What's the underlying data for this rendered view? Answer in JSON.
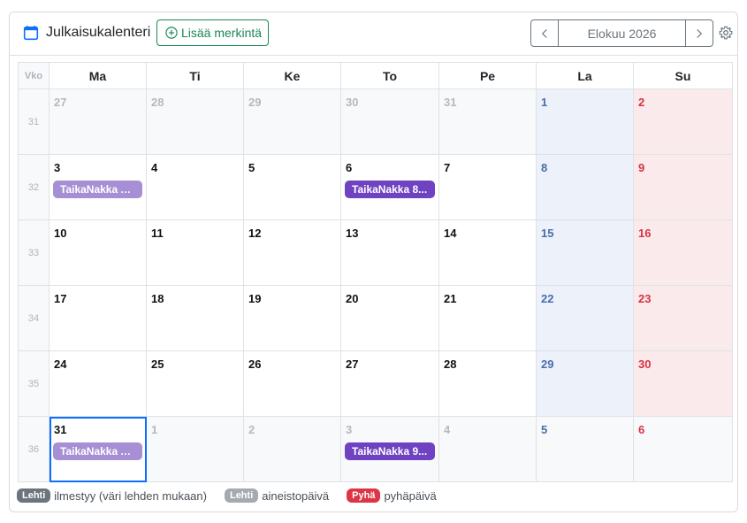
{
  "header": {
    "title": "Julkaisukalenteri",
    "add_label": "Lisää merkintä",
    "month_label": "Elokuu 2026",
    "icons": [
      "calendar-icon",
      "plus-circle-icon",
      "chevron-left-icon",
      "chevron-right-icon",
      "gear-icon"
    ]
  },
  "grid": {
    "week_header": "Vko",
    "day_headers": [
      "Ma",
      "Ti",
      "Ke",
      "To",
      "Pe",
      "La",
      "Su"
    ],
    "weeks": [
      {
        "number": "31",
        "days": [
          {
            "num": "27",
            "out": true
          },
          {
            "num": "28",
            "out": true
          },
          {
            "num": "29",
            "out": true
          },
          {
            "num": "30",
            "out": true
          },
          {
            "num": "31",
            "out": true
          },
          {
            "num": "1"
          },
          {
            "num": "2"
          }
        ]
      },
      {
        "number": "32",
        "days": [
          {
            "num": "3",
            "event": {
              "label": "TaikaNakka A...",
              "kind": "aineisto"
            }
          },
          {
            "num": "4"
          },
          {
            "num": "5"
          },
          {
            "num": "6",
            "event": {
              "label": "TaikaNakka 8...",
              "kind": "ilmestyy"
            }
          },
          {
            "num": "7"
          },
          {
            "num": "8"
          },
          {
            "num": "9"
          }
        ]
      },
      {
        "number": "33",
        "days": [
          {
            "num": "10"
          },
          {
            "num": "11"
          },
          {
            "num": "12"
          },
          {
            "num": "13"
          },
          {
            "num": "14"
          },
          {
            "num": "15"
          },
          {
            "num": "16"
          }
        ]
      },
      {
        "number": "34",
        "days": [
          {
            "num": "17"
          },
          {
            "num": "18"
          },
          {
            "num": "19"
          },
          {
            "num": "20"
          },
          {
            "num": "21"
          },
          {
            "num": "22"
          },
          {
            "num": "23"
          }
        ]
      },
      {
        "number": "35",
        "days": [
          {
            "num": "24"
          },
          {
            "num": "25"
          },
          {
            "num": "26"
          },
          {
            "num": "27"
          },
          {
            "num": "28"
          },
          {
            "num": "29"
          },
          {
            "num": "30"
          }
        ]
      },
      {
        "number": "36",
        "days": [
          {
            "num": "31",
            "selected": true,
            "event": {
              "label": "TaikaNakka A...",
              "kind": "aineisto"
            }
          },
          {
            "num": "1",
            "out": true
          },
          {
            "num": "2",
            "out": true
          },
          {
            "num": "3",
            "out": true,
            "event": {
              "label": "TaikaNakka 9...",
              "kind": "ilmestyy"
            }
          },
          {
            "num": "4",
            "out": true
          },
          {
            "num": "5",
            "out": true
          },
          {
            "num": "6",
            "out": true
          }
        ]
      }
    ]
  },
  "legend": [
    {
      "badge": "Lehti",
      "text": "ilmestyy (väri lehden mukaan)",
      "color": "#6c757d"
    },
    {
      "badge": "Lehti",
      "text": "aineistopäivä",
      "color": "#a5aab0"
    },
    {
      "badge": "Pyhä",
      "text": "pyhäpäivä",
      "color": "#dc3545"
    }
  ],
  "colors": {
    "accent": "#198754",
    "event_ilmestyy": "#6f42c1",
    "event_aineisto": "#a68fd4",
    "selected_outline": "#0d6efd",
    "saturday_bg": "#ecf1fa",
    "sunday_bg": "#fbeaeb"
  }
}
